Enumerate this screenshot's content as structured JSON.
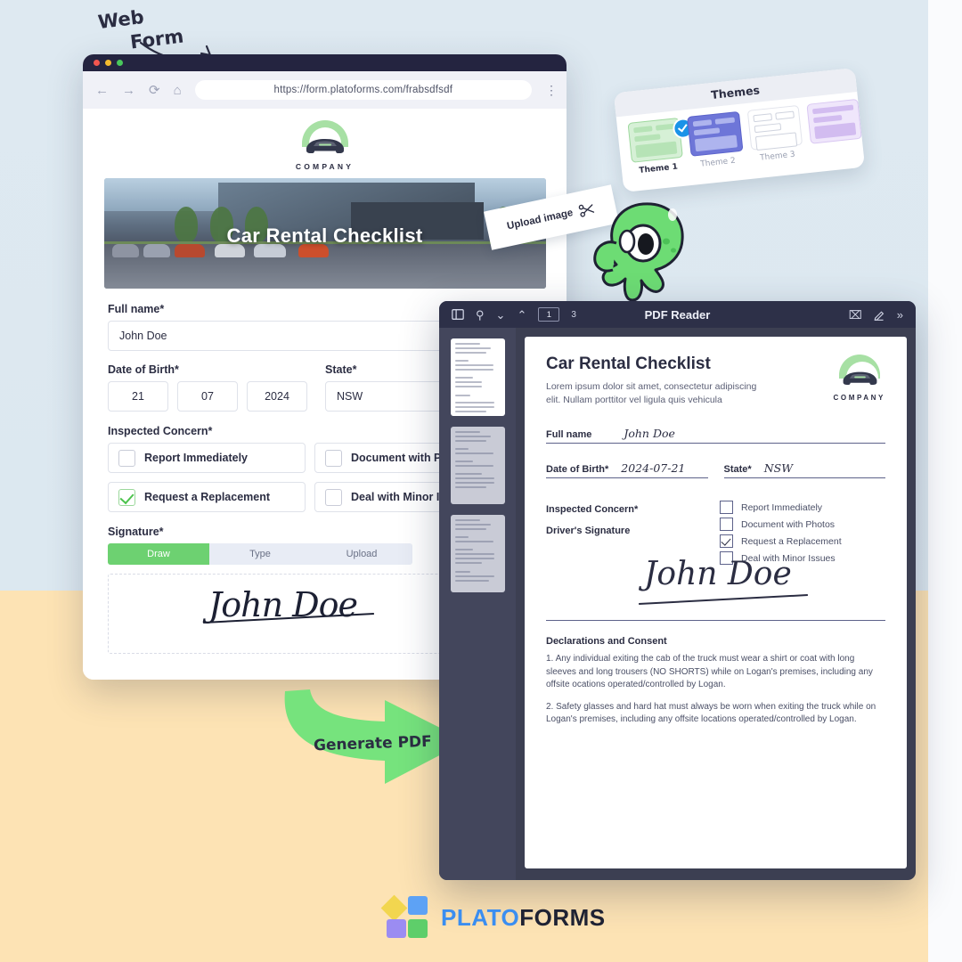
{
  "annotations": {
    "web_form_line1": "Web",
    "web_form_line2": "Form",
    "upload_image": "Upload image",
    "generate_pdf": "Generate PDF"
  },
  "browser": {
    "url": "https://form.platoforms.com/frabsdfsdf",
    "back_icon": "arrow-left-icon",
    "forward_icon": "arrow-right-icon",
    "reload_icon": "reload-icon",
    "home_icon": "home-icon",
    "menu_icon": "kebab-menu-icon"
  },
  "webform": {
    "company_name": "COMPANY",
    "hero_title": "Car Rental Checklist",
    "fields": {
      "full_name_label": "Full name*",
      "full_name_value": "John Doe",
      "dob_label": "Date of Birth*",
      "dob_day": "21",
      "dob_month": "07",
      "dob_year": "2024",
      "state_label": "State*",
      "state_value": "NSW",
      "concern_label": "Inspected Concern*",
      "signature_label": "Signature*"
    },
    "checkboxes": [
      {
        "label": "Report Immediately",
        "checked": false
      },
      {
        "label": "Document with Photos",
        "checked": false
      },
      {
        "label": "Request a Replacement",
        "checked": true
      },
      {
        "label": "Deal with Minor Issues",
        "checked": false
      }
    ],
    "signature_tabs": [
      {
        "label": "Draw",
        "active": true
      },
      {
        "label": "Type",
        "active": false
      },
      {
        "label": "Upload",
        "active": false
      }
    ],
    "signature_value": "John Doe"
  },
  "themes": {
    "title": "Themes",
    "items": [
      {
        "label": "Theme 1",
        "selected": true
      },
      {
        "label": "Theme 2",
        "selected": false
      },
      {
        "label": "Theme 3",
        "selected": false
      },
      {
        "label": "",
        "selected": false
      }
    ],
    "check_color": "#1a93e8"
  },
  "pdf_reader": {
    "title": "PDF Reader",
    "sidebar_toggle_icon": "sidebar-toggle-icon",
    "search_icon": "search-icon",
    "prev_icon": "chevron-down-icon",
    "next_icon": "chevron-up-icon",
    "current_page": "1",
    "total_pages": "3",
    "text_select_icon": "text-cursor-icon",
    "highlight_icon": "pencil-highlight-icon",
    "more_icon": "chevron-double-right-icon",
    "thumbnails": [
      {
        "page": "1",
        "active": true
      },
      {
        "page": "2",
        "active": false
      },
      {
        "page": "3",
        "active": false
      }
    ],
    "document": {
      "title": "Car Rental Checklist",
      "subtitle": "Lorem ipsum dolor sit amet, consectetur adipiscing elit. Nullam porttitor vel ligula quis vehicula",
      "company_name": "COMPANY",
      "full_name_label": "Full name",
      "full_name_value": "John Doe",
      "dob_label": "Date of Birth*",
      "dob_value": "2024-07-21",
      "state_label": "State*",
      "state_value": "NSW",
      "concern_label": "Inspected Concern*",
      "checkboxes": [
        {
          "label": "Report Immediately",
          "checked": false
        },
        {
          "label": "Document with Photos",
          "checked": false
        },
        {
          "label": "Request a Replacement",
          "checked": true
        },
        {
          "label": "Deal with Minor Issues",
          "checked": false
        }
      ],
      "signature_label": "Driver's Signature",
      "signature_value": "John Doe",
      "declarations_title": "Declarations and Consent",
      "declaration_1": "1. Any individual exiting the cab of the truck must wear a shirt or coat with long sleeves and long trousers (NO SHORTS) while on Logan's premises, including any offsite ocations operated/controlled by Logan.",
      "declaration_2": "2. Safety glasses and hard hat must always be worn when exiting the truck while on Logan's premises, including any offsite locations operated/controlled by Logan."
    }
  },
  "footer": {
    "brand_part1": "PLATO",
    "brand_part2": "FORMS"
  },
  "colors": {
    "bg_top": "#dee9f1",
    "bg_bottom": "#fde3b4",
    "accent_green": "#6dd171",
    "pdf_chrome": "#2d3048",
    "brand_blue": "#3b8ef0"
  }
}
